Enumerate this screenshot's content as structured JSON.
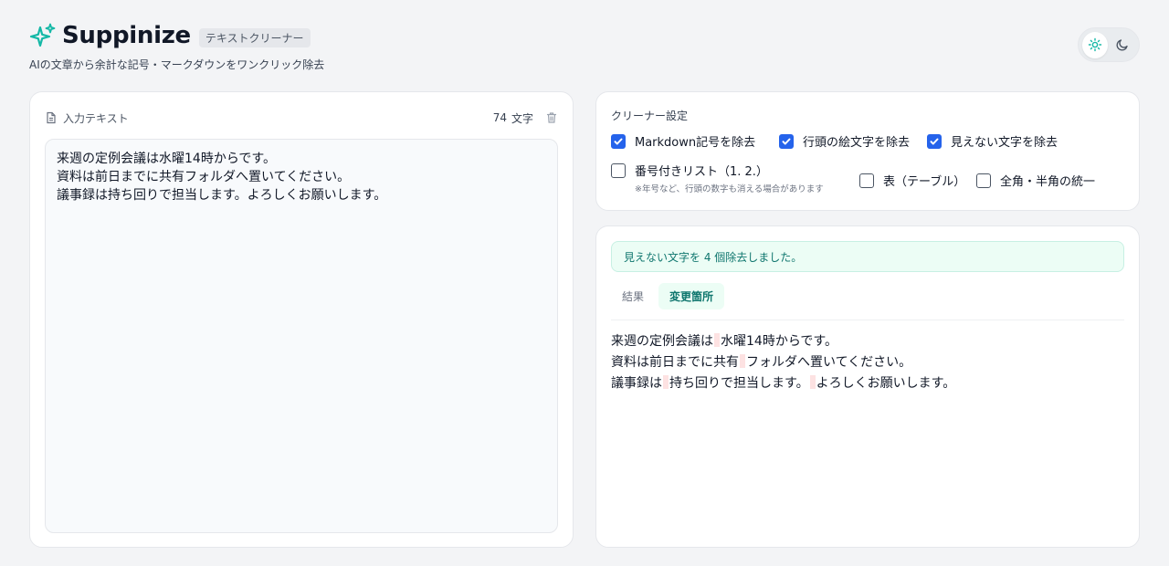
{
  "app": {
    "name": "Suppinize",
    "tag": "テキストクリーナー",
    "subtitle": "AIの文章から余計な記号・マークダウンをワンクリック除去",
    "accent": "#14b8a6"
  },
  "theme": {
    "light_icon": "sun-icon",
    "dark_icon": "moon-icon",
    "selected": "light"
  },
  "input": {
    "title": "入力テキスト",
    "char_count": "74",
    "char_unit": "文字",
    "lines": [
      "来週の定例会議は水曜14時からです。",
      "資料は前日までに共有フォルダへ置いてください。",
      "議事録は持ち回りで担当します。よろしくお願いします。"
    ]
  },
  "settings": {
    "title": "クリーナー設定",
    "options": [
      {
        "label": "Markdown記号を除去",
        "checked": true
      },
      {
        "label": "行頭の絵文字を除去",
        "checked": true
      },
      {
        "label": "見えない文字を除去",
        "checked": true
      },
      {
        "label": "番号付きリスト（1. 2.）",
        "checked": false
      },
      {
        "label": "表（テーブル）",
        "checked": false
      },
      {
        "label": "全角・半角の統一",
        "checked": false
      }
    ],
    "note": "※年号など、行頭の数字も消える場合があります"
  },
  "result": {
    "notice": "見えない文字を 4 個除去しました。",
    "tabs": [
      "結果",
      "変更箇所"
    ],
    "active_tab": "変更箇所",
    "diff_lines": [
      [
        "来週の定例会議は",
        "水曜14時からです。"
      ],
      [
        "資料は前日までに共有",
        "フォルダへ置いてください。"
      ],
      [
        "議事録は",
        "持ち回りで担当します。",
        "よろしくお願いします。"
      ]
    ],
    "highlight_color": "#fde2e2"
  }
}
